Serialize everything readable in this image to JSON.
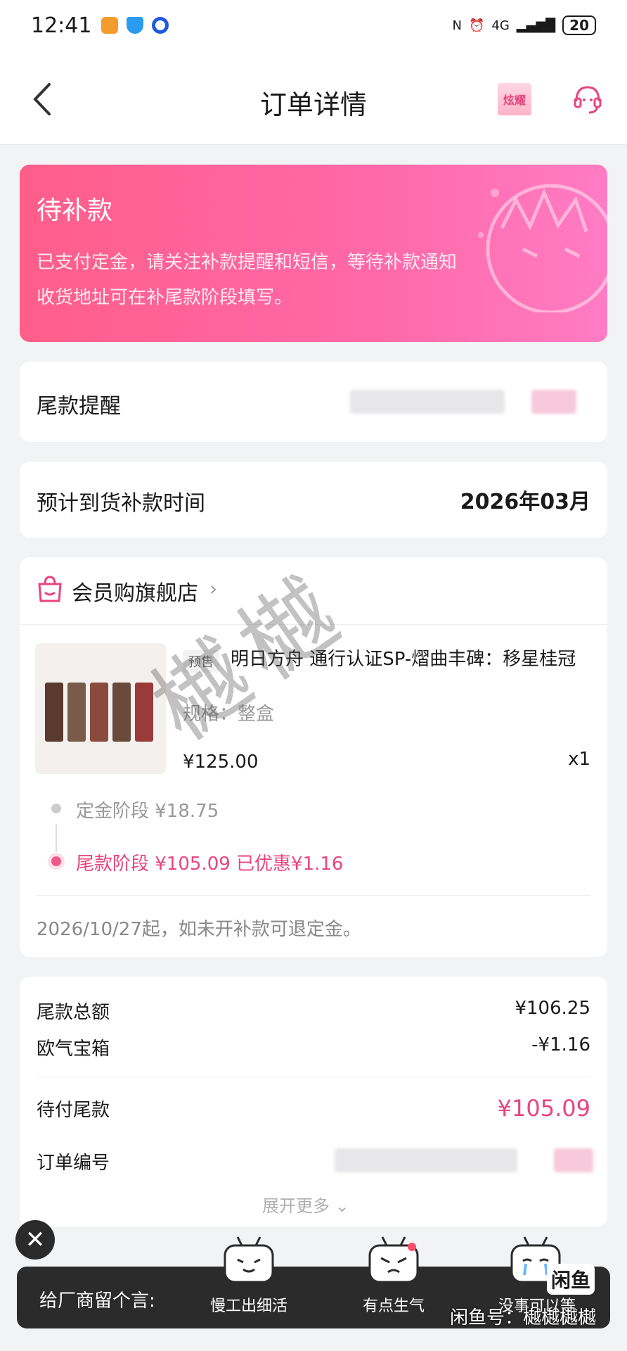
{
  "status_bar": {
    "time": "12:41",
    "battery": "20",
    "network": "4G"
  },
  "header": {
    "title": "订单详情",
    "badge_label": "炫耀"
  },
  "banner": {
    "title": "待补款",
    "desc_line1": "已支付定金，请关注补款提醒和短信，等待补款通知",
    "desc_line2": "收货地址可在补尾款阶段填写。"
  },
  "reminder": {
    "label": "尾款提醒"
  },
  "arrival": {
    "label": "预计到货补款时间",
    "value": "2026年03月"
  },
  "store": {
    "name": "会员购旗舰店"
  },
  "product": {
    "tag": "预售",
    "title": "明日方舟 通行认证SP-熠曲丰碑：移星桂冠",
    "spec": "规格：整盒",
    "price": "¥125.00",
    "qty": "x1"
  },
  "stages": {
    "deposit": "定金阶段  ¥18.75",
    "final": "尾款阶段  ¥105.09  已优惠¥1.16"
  },
  "refund_note": "2026/10/27起，如未开补款可退定金。",
  "summary": {
    "total_label": "尾款总额",
    "total_value": "¥106.25",
    "box_label": "欧气宝箱",
    "box_value": "-¥1.16",
    "due_label": "待付尾款",
    "due_value": "¥105.09",
    "order_label": "订单编号",
    "expand_label": "展开更多"
  },
  "watermark": "樾樾",
  "bottom_bar": {
    "label": "给厂商留个言:",
    "option1": "慢工出细活",
    "option2": "有点生气",
    "option3": "没事可以等",
    "overlay_id": "闲鱼号：樾樾樾樾",
    "overlay_logo": "闲鱼"
  },
  "colors": {
    "accent": "#ff5e8a",
    "price_pink": "#e8467c"
  }
}
